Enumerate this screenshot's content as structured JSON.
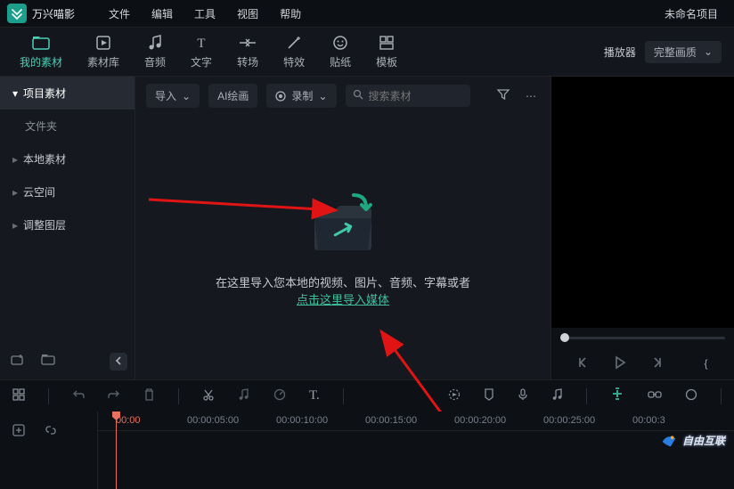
{
  "app": {
    "name": "万兴喵影",
    "project_title": "未命名项目"
  },
  "menu": {
    "file": "文件",
    "edit": "编辑",
    "tools": "工具",
    "view": "视图",
    "help": "帮助"
  },
  "tabs": {
    "my_media": "我的素材",
    "media_lib": "素材库",
    "audio": "音频",
    "text": "文字",
    "transition": "转场",
    "effects": "特效",
    "stickers": "贴纸",
    "templates": "模板"
  },
  "preview": {
    "player_label": "播放器",
    "quality": "完整画质"
  },
  "sidebar": {
    "project_media": "项目素材",
    "folder": "文件夹",
    "local_media": "本地素材",
    "cloud": "云空间",
    "adjustment": "调整图层"
  },
  "content_top": {
    "import": "导入",
    "ai_draw": "AI绘画",
    "record": "录制",
    "search_placeholder": "搜索素材"
  },
  "import_area": {
    "line1": "在这里导入您本地的视频、图片、音频、字幕或者",
    "link": "点击这里导入媒体"
  },
  "timeline": {
    "marks": [
      "00:00",
      "00:00:05:00",
      "00:00:10:00",
      "00:00:15:00",
      "00:00:20:00",
      "00:00:25:00",
      "00:00:3"
    ]
  },
  "watermark": {
    "text": "自由互联"
  }
}
